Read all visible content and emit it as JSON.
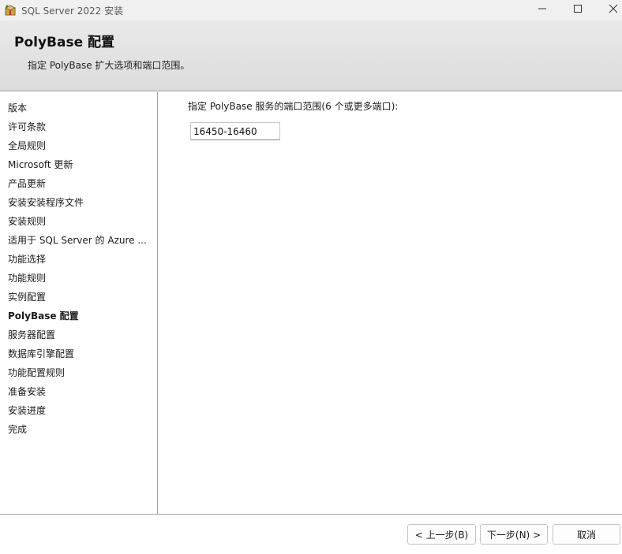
{
  "window": {
    "title": "SQL Server 2022 安装",
    "app_icon": "sql-server-setup-box-icon",
    "controls": {
      "minimize_icon": "minimize-icon",
      "maximize_icon": "maximize-icon",
      "close_icon": "close-icon"
    }
  },
  "header": {
    "title": "PolyBase 配置",
    "subtitle": "指定 PolyBase 扩大选项和端口范围。"
  },
  "nav": {
    "items": [
      {
        "label": "版本"
      },
      {
        "label": "许可条款"
      },
      {
        "label": "全局规则"
      },
      {
        "label": "Microsoft 更新"
      },
      {
        "label": "产品更新"
      },
      {
        "label": "安装安装程序文件"
      },
      {
        "label": "安装规则"
      },
      {
        "label": "适用于 SQL Server 的 Azure ..."
      },
      {
        "label": "功能选择"
      },
      {
        "label": "功能规则"
      },
      {
        "label": "实例配置"
      },
      {
        "label": "PolyBase 配置"
      },
      {
        "label": "服务器配置"
      },
      {
        "label": "数据库引擎配置"
      },
      {
        "label": "功能配置规则"
      },
      {
        "label": "准备安装"
      },
      {
        "label": "安装进度"
      },
      {
        "label": "完成"
      }
    ],
    "active_item": "PolyBase 配置"
  },
  "main": {
    "port_range_label": "指定 PolyBase 服务的端口范围(6 个或更多端口):",
    "port_range_value": "16450-16460"
  },
  "footer": {
    "back_label": "< 上一步(B)",
    "next_label": "下一步(N) >",
    "cancel_label": "取消"
  }
}
